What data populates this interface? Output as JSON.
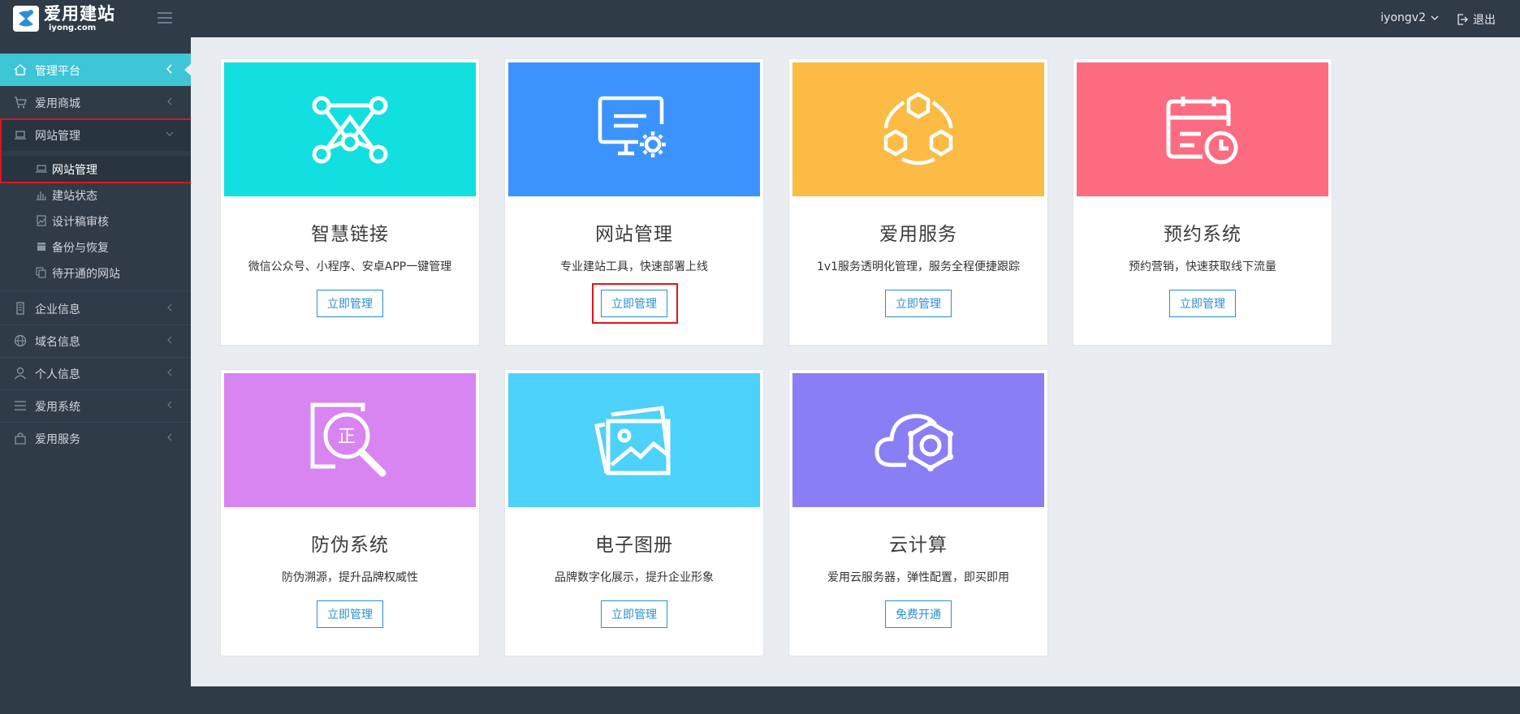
{
  "header": {
    "logo_cn": "爱用建站",
    "logo_en": "iyong.com",
    "username": "iyongv2",
    "logout_label": "退出"
  },
  "sidebar": {
    "items": [
      {
        "label": "管理平台",
        "icon": "home-icon"
      },
      {
        "label": "爱用商城",
        "icon": "cart-icon"
      },
      {
        "label": "网站管理",
        "icon": "laptop-icon"
      },
      {
        "label": "企业信息",
        "icon": "building-icon"
      },
      {
        "label": "域名信息",
        "icon": "globe-icon"
      },
      {
        "label": "个人信息",
        "icon": "user-icon"
      },
      {
        "label": "爱用系统",
        "icon": "list-icon"
      },
      {
        "label": "爱用服务",
        "icon": "bag-icon"
      }
    ],
    "subitems": [
      {
        "label": "网站管理",
        "icon": "laptop-icon"
      },
      {
        "label": "建站状态",
        "icon": "bar-chart-icon"
      },
      {
        "label": "设计稿审核",
        "icon": "image-icon"
      },
      {
        "label": "备份与恢复",
        "icon": "archive-icon"
      },
      {
        "label": "待开通的网站",
        "icon": "copy-icon"
      }
    ]
  },
  "cards": [
    {
      "title": "智慧链接",
      "desc": "微信公众号、小程序、安卓APP一键管理",
      "button": "立即管理",
      "color": "#12e0e0",
      "icon": "network-nodes-icon"
    },
    {
      "title": "网站管理",
      "desc": "专业建站工具，快速部署上线",
      "button": "立即管理",
      "color": "#3d93fd",
      "icon": "monitor-gear-icon"
    },
    {
      "title": "爱用服务",
      "desc": "1v1服务透明化管理，服务全程便捷跟踪",
      "button": "立即管理",
      "color": "#fbbb44",
      "icon": "hexagon-cycle-icon"
    },
    {
      "title": "预约系统",
      "desc": "预约营销，快速获取线下流量",
      "button": "立即管理",
      "color": "#fd6b81",
      "icon": "calendar-clock-icon"
    },
    {
      "title": "防伪系统",
      "desc": "防伪溯源，提升品牌权威性",
      "button": "立即管理",
      "color": "#d884f1",
      "icon": "magnifier-seal-icon"
    },
    {
      "title": "电子图册",
      "desc": "品牌数字化展示，提升企业形象",
      "button": "立即管理",
      "color": "#4cd2fb",
      "icon": "photo-album-icon"
    },
    {
      "title": "云计算",
      "desc": "爱用云服务器，弹性配置，即买即用",
      "button": "免费开通",
      "color": "#8a7ef5",
      "icon": "cloud-gear-icon"
    }
  ],
  "icon_glyphs": {
    "seal_char": "正"
  },
  "colors": {
    "topbar": "#2f3b47",
    "accent": "#3ec5d6",
    "button": "#2c8fd0",
    "highlight": "#e1141b"
  }
}
